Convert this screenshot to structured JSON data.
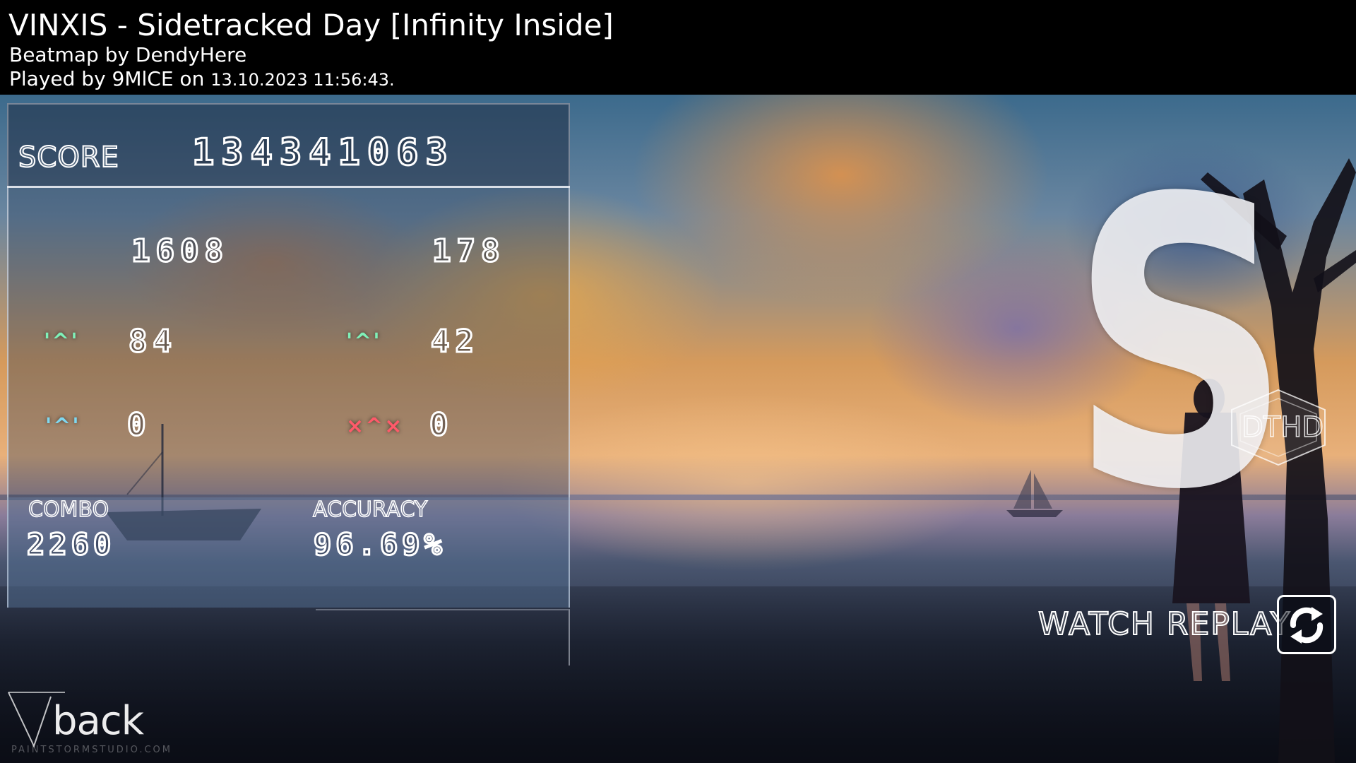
{
  "header": {
    "title": "VINXIS - Sidetracked Day [Infinity Inside]",
    "mapper": "Beatmap by DendyHere",
    "played_prefix": "Played by 9MlCE on",
    "played_date": "13.10.2023 11:56:43."
  },
  "score": {
    "label": "SCORE",
    "value": "134341063"
  },
  "hits": {
    "count_300": "1608",
    "count_geki": "178",
    "count_100": "84",
    "count_katu": "42",
    "count_50": "0",
    "count_miss": "0",
    "icon_100": "'^'",
    "icon_katu": "'^'",
    "icon_50": "'^'",
    "icon_miss": "×^×"
  },
  "stats": {
    "combo_label": "COMBO",
    "combo_value": "2260",
    "accuracy_label": "ACCURACY",
    "accuracy_value": "96.69%"
  },
  "rank": {
    "grade": "S",
    "mods": "DTHD"
  },
  "actions": {
    "watch_replay": "WATCH REPLAY",
    "back": "back"
  },
  "watermark": "PAINTSTORMSTUDIO.COM",
  "icons": {
    "replay": "replay-arrows-icon",
    "back": "back-arrow-icon"
  },
  "colors": {
    "judge_green": "#7ff0b8",
    "judge_blue": "#7fd8f0",
    "judge_miss": "#ff5a6a"
  }
}
